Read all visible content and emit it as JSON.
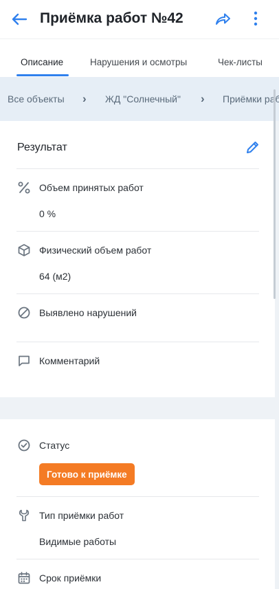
{
  "header": {
    "title": "Приёмка работ №42"
  },
  "tabs": [
    {
      "label": "Описание",
      "active": true
    },
    {
      "label": "Нарушения и осмотры",
      "active": false
    },
    {
      "label": "Чек-листы",
      "active": false
    }
  ],
  "breadcrumbs": [
    "Все объекты",
    "ЖД \"Солнечный\"",
    "Приёмки работ"
  ],
  "result_card": {
    "title": "Результат",
    "rows": [
      {
        "icon": "percent-icon",
        "label": "Объем принятых работ",
        "value": "0 %"
      },
      {
        "icon": "cube-icon",
        "label": "Физический объем работ",
        "value": "64 (м2)"
      },
      {
        "icon": "violation-icon",
        "label": "Выявлено нарушений",
        "value": ""
      },
      {
        "icon": "comment-icon",
        "label": "Комментарий",
        "value": ""
      }
    ]
  },
  "details_card": {
    "rows": [
      {
        "icon": "check-circle-icon",
        "label": "Статус",
        "badge": "Готово к приёмке"
      },
      {
        "icon": "wrench-icon",
        "label": "Тип приёмки работ",
        "value": "Видимые работы"
      },
      {
        "icon": "calendar-icon",
        "label": "Срок приёмки",
        "value": ""
      }
    ]
  },
  "colors": {
    "accent": "#2f80ed",
    "status_badge": "#f47b24",
    "breadcrumb_bg": "#e6eef6",
    "page_bg": "#eef2f6"
  }
}
